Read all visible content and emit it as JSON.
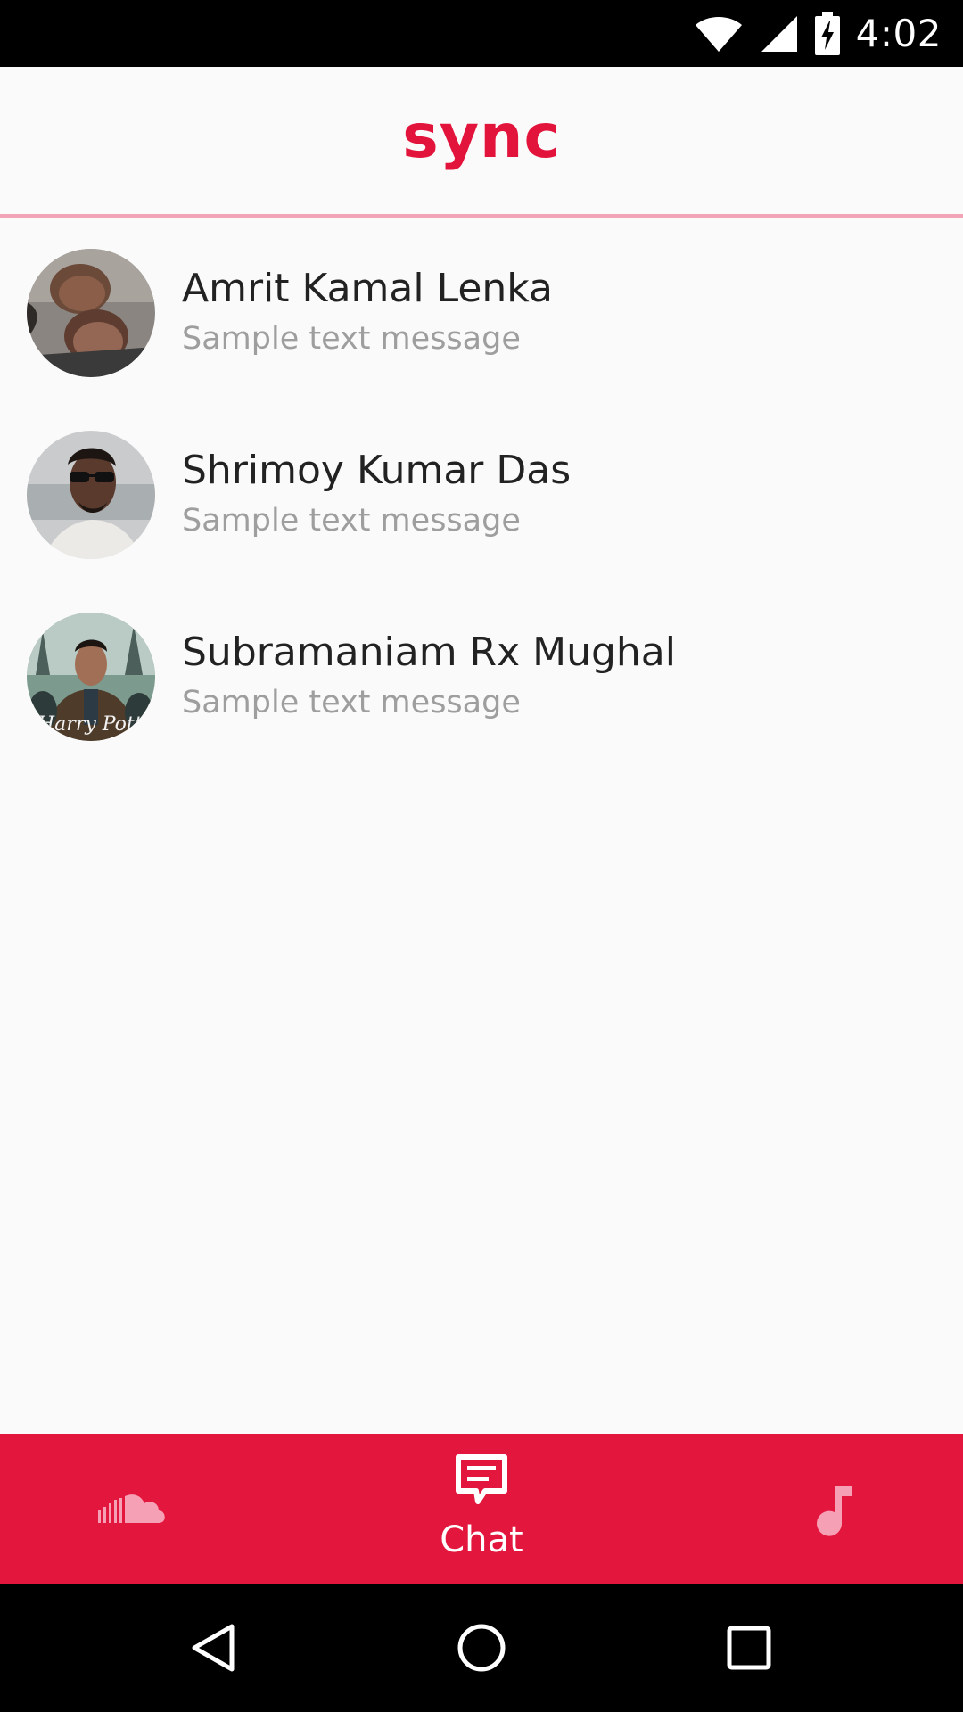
{
  "status_bar": {
    "time": "4:02",
    "icons": [
      "wifi-icon",
      "cellular-signal-icon",
      "battery-charging-icon"
    ]
  },
  "app_bar": {
    "title": "sync",
    "accent_color": "#e3143c"
  },
  "chats": [
    {
      "name": "Amrit Kamal Lenka",
      "preview": "Sample text message"
    },
    {
      "name": "Shrimoy Kumar Das",
      "preview": "Sample text message"
    },
    {
      "name": "Subramaniam Rx Mughal",
      "preview": "Sample text message"
    }
  ],
  "bottom_nav": {
    "background": "#e3163d",
    "items": [
      {
        "icon": "soundcloud-icon",
        "label": "",
        "active": false
      },
      {
        "icon": "chat-icon",
        "label": "Chat",
        "active": true
      },
      {
        "icon": "music-note-icon",
        "label": "",
        "active": false
      }
    ]
  },
  "system_nav": {
    "icons": [
      "back-icon",
      "home-icon",
      "recents-icon"
    ]
  }
}
